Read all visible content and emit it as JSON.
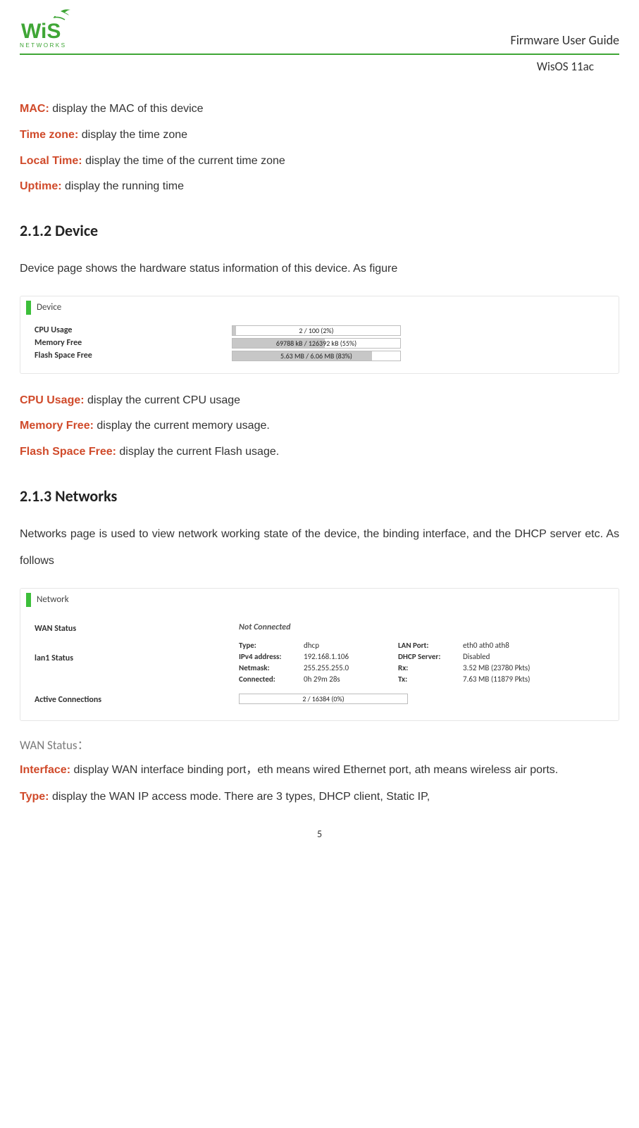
{
  "header": {
    "title_right": "Firmware User Guide",
    "sub_right": "WisOS 11ac"
  },
  "intro_defs": [
    {
      "term": "MAC:",
      "desc": "display the MAC of this device"
    },
    {
      "term": "Time zone:",
      "desc": "display the time zone"
    },
    {
      "term": "Local Time:",
      "desc": "display the time of the current time zone"
    },
    {
      "term": "Uptime:",
      "desc": "display the running time"
    }
  ],
  "section_device": {
    "number_title": "2.1.2  Device",
    "intro": "Device page shows the hardware status information of this device. As figure",
    "panel_title": "Device",
    "metrics": [
      {
        "label": "CPU Usage",
        "text": "2 / 100 (2%)",
        "pct": 2
      },
      {
        "label": "Memory Free",
        "text": "69788 kB / 126392 kB (55%)",
        "pct": 55
      },
      {
        "label": "Flash Space Free",
        "text": "5.63 MB / 6.06 MB (83%)",
        "pct": 83
      }
    ],
    "defs": [
      {
        "term": "CPU Usage:",
        "desc": "display the current CPU usage"
      },
      {
        "term": "Memory Free:",
        "desc": "display the current memory usage."
      },
      {
        "term": "Flash Space Free:",
        "desc": "display the current Flash usage."
      }
    ]
  },
  "section_networks": {
    "number_title": "2.1.3  Networks",
    "intro": "Networks page is used to view network working state of the device, the binding interface, and the DHCP server etc. As follows",
    "panel_title": "Network",
    "wan": {
      "label": "WAN Status",
      "status": "Not Connected"
    },
    "lan": {
      "label": "lan1 Status",
      "rows": [
        {
          "k1": "Type:",
          "v1": "dhcp",
          "k2": "LAN Port:",
          "v2": "eth0 ath0 ath8"
        },
        {
          "k1": "IPv4 address:",
          "v1": "192.168.1.106",
          "k2": "DHCP Server:",
          "v2": "Disabled"
        },
        {
          "k1": "Netmask:",
          "v1": "255.255.255.0",
          "k2": "Rx:",
          "v2": "3.52 MB (23780 Pkts)"
        },
        {
          "k1": "Connected:",
          "v1": "0h 29m 28s",
          "k2": "Tx:",
          "v2": "7.63 MB (11879 Pkts)"
        }
      ]
    },
    "active_conn": {
      "label": "Active Connections",
      "text": "2 / 16384 (0%)",
      "pct": 0
    },
    "wan_status_heading": "WAN Status：",
    "defs": [
      {
        "term": "Interface:",
        "desc": "display WAN interface binding port，eth means wired Ethernet port, ath means wireless air ports."
      },
      {
        "term": "Type:",
        "desc": "display the WAN IP access mode. There are 3 types, DHCP client, Static IP,"
      }
    ]
  },
  "page_number": "5"
}
